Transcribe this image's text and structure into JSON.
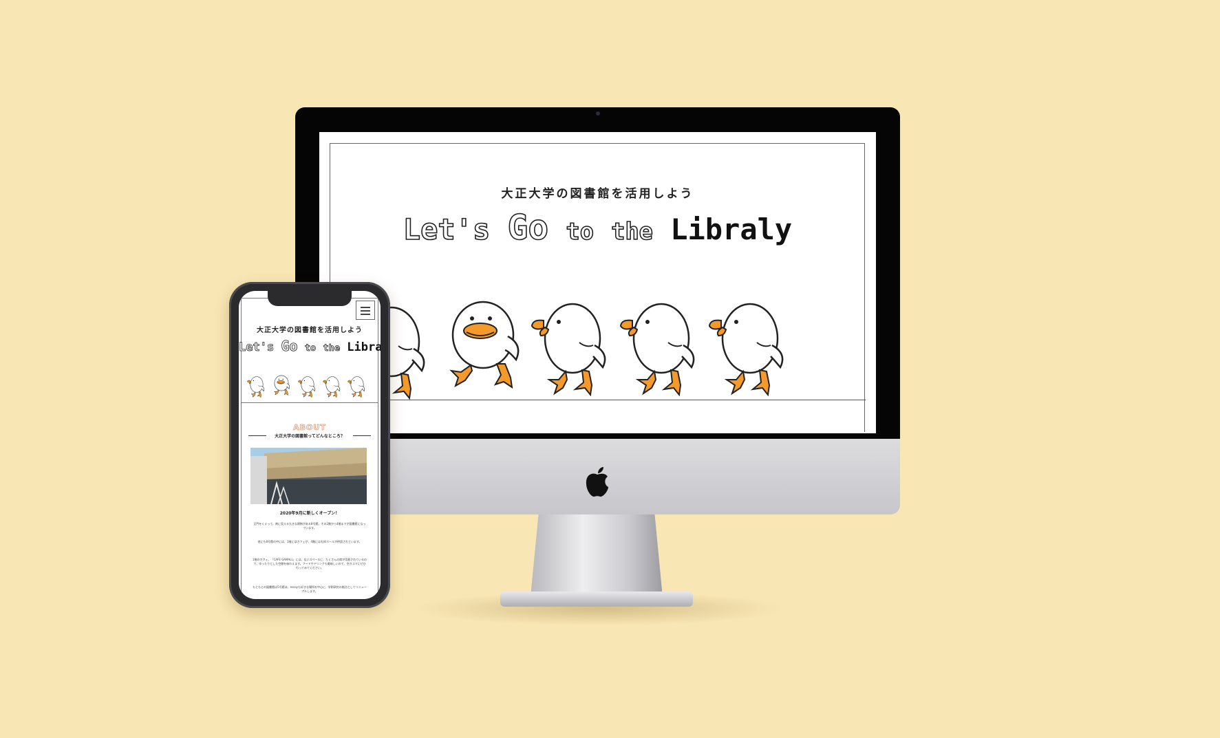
{
  "desktop": {
    "subtitle": "大正大学の図書館を活用しよう",
    "title": {
      "lets": "Let's",
      "go": "Go",
      "to": "to",
      "the": "the",
      "libraly": "Libraly"
    }
  },
  "mobile": {
    "subtitle": "大正大学の図書館を活用しよう",
    "title": {
      "lets": "Let's",
      "go": "Go",
      "to": "to",
      "the": "the",
      "libraly": "Libraly"
    },
    "about": {
      "label": "ABOUT",
      "heading": "大正大学の図書館ってどんなところ？",
      "date": "2020年9月に新しくオープン！",
      "paragraphs": [
        "正門をくぐって、南に見える大きな建物がある8号館。その2階から4階までが図書館になっています。",
        "他にも8号館の中には、1階にはカフェが、4階には礼拝ホールが併設されています。",
        "1階のカフェ、「CAFE GAMALL」には、広いスペースに、たくさんの席が用意されているので、ゆったりとした空間を味わえます。フードやドリンクも美味しいので、空きコマにぜひ行ってみてください。",
        "もともとの図書館は5号館は、essayも好きな場所を中心に、学術研究の拠点としてリニューアルします。"
      ]
    }
  },
  "colors": {
    "background": "#f8e6b4",
    "duck_orange": "#f39a2a",
    "outline": "#222222"
  }
}
